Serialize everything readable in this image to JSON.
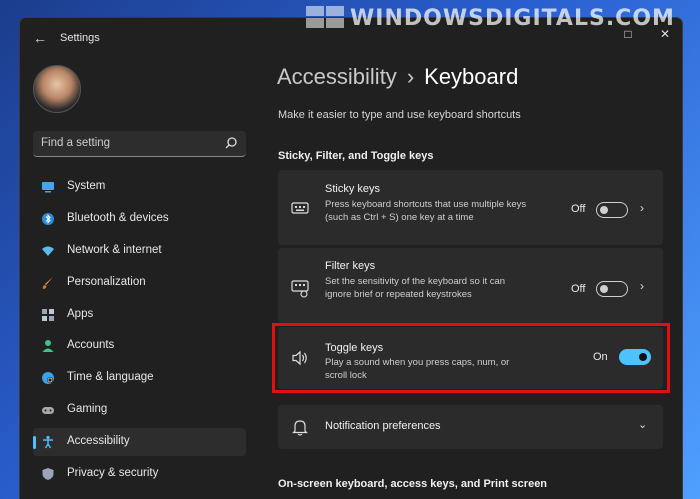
{
  "window": {
    "title": "Settings"
  },
  "watermark": "WINDOWSDIGITALS.COM",
  "search": {
    "placeholder": "Find a setting"
  },
  "sidebar": {
    "items": [
      {
        "label": "System",
        "icon": "system-icon",
        "color": "#4aa3e8"
      },
      {
        "label": "Bluetooth & devices",
        "icon": "bluetooth-icon",
        "color": "#2a8be0"
      },
      {
        "label": "Network & internet",
        "icon": "wifi-icon",
        "color": "#5bb8f0"
      },
      {
        "label": "Personalization",
        "icon": "brush-icon",
        "color": "#e8a14a"
      },
      {
        "label": "Apps",
        "icon": "apps-icon",
        "color": "#9aa6b8"
      },
      {
        "label": "Accounts",
        "icon": "accounts-icon",
        "color": "#3fc18b"
      },
      {
        "label": "Time & language",
        "icon": "globe-icon",
        "color": "#3ea0e8"
      },
      {
        "label": "Gaming",
        "icon": "gamepad-icon",
        "color": "#a8a8a8"
      },
      {
        "label": "Accessibility",
        "icon": "accessibility-icon",
        "color": "#4cc2ff"
      },
      {
        "label": "Privacy & security",
        "icon": "shield-icon",
        "color": "#9aa6b8"
      }
    ],
    "active_index": 8
  },
  "main": {
    "breadcrumb_parent": "Accessibility",
    "breadcrumb_separator": "›",
    "breadcrumb_current": "Keyboard",
    "subtitle": "Make it easier to type and use keyboard shortcuts",
    "section1": "Sticky, Filter, and Toggle keys",
    "cards": [
      {
        "title": "Sticky keys",
        "desc": "Press keyboard shortcuts that use multiple keys (such as Ctrl + S) one key at a time",
        "state": "Off",
        "on": false,
        "icon": "sticky-keys-icon"
      },
      {
        "title": "Filter keys",
        "desc": "Set the sensitivity of the keyboard so it can ignore brief or repeated keystrokes",
        "state": "Off",
        "on": false,
        "icon": "filter-keys-icon"
      },
      {
        "title": "Toggle keys",
        "desc": "Play a sound when you press caps, num, or scroll lock",
        "state": "On",
        "on": true,
        "icon": "speaker-icon"
      }
    ],
    "notification": "Notification preferences",
    "section2": "On-screen keyboard, access keys, and Print screen"
  },
  "accent_color": "#4cc2ff",
  "highlight_color": "#e01010"
}
